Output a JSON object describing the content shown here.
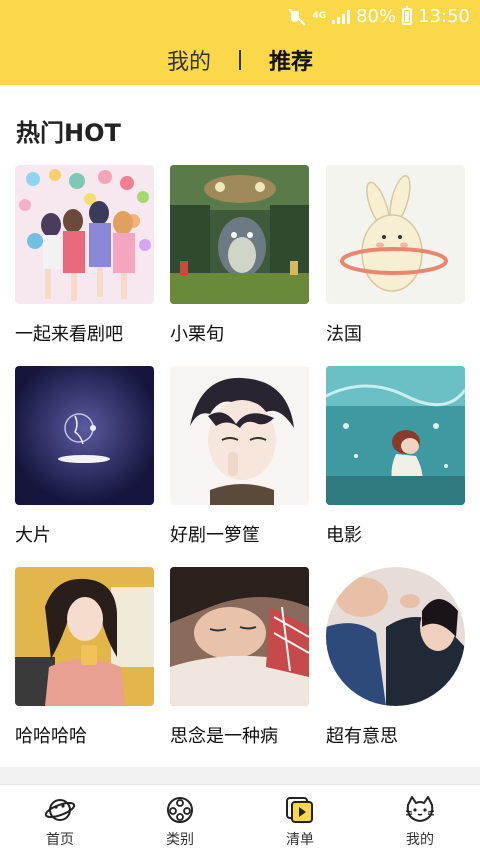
{
  "status_bar": {
    "network": "4G",
    "battery": "80%",
    "time": "13:50"
  },
  "header": {
    "tabs": [
      "我的",
      "推荐"
    ],
    "active_tab": 1
  },
  "section": {
    "title": "热门HOT"
  },
  "items": [
    {
      "label": "一起来看剧吧",
      "icon": "anime-girls-image"
    },
    {
      "label": "小栗旬",
      "icon": "totoro-forest-image"
    },
    {
      "label": "法国",
      "icon": "bunny-hoop-image"
    },
    {
      "label": "大片",
      "icon": "neon-sign-image"
    },
    {
      "label": "好剧一箩筐",
      "icon": "manga-boy-image"
    },
    {
      "label": "电影",
      "icon": "underwater-girl-image"
    },
    {
      "label": "哈哈哈哈",
      "icon": "girl-drink-image"
    },
    {
      "label": "思念是一种病",
      "icon": "sleepy-boy-image"
    },
    {
      "label": "超有意思",
      "icon": "couple-round-image"
    }
  ],
  "bottom_nav": [
    {
      "label": "首页",
      "icon": "planet-icon"
    },
    {
      "label": "类别",
      "icon": "film-reel-icon"
    },
    {
      "label": "清单",
      "icon": "playlist-icon"
    },
    {
      "label": "我的",
      "icon": "cat-face-icon"
    }
  ],
  "colors": {
    "accent": "#fbd84a",
    "background": "#ffffff"
  }
}
